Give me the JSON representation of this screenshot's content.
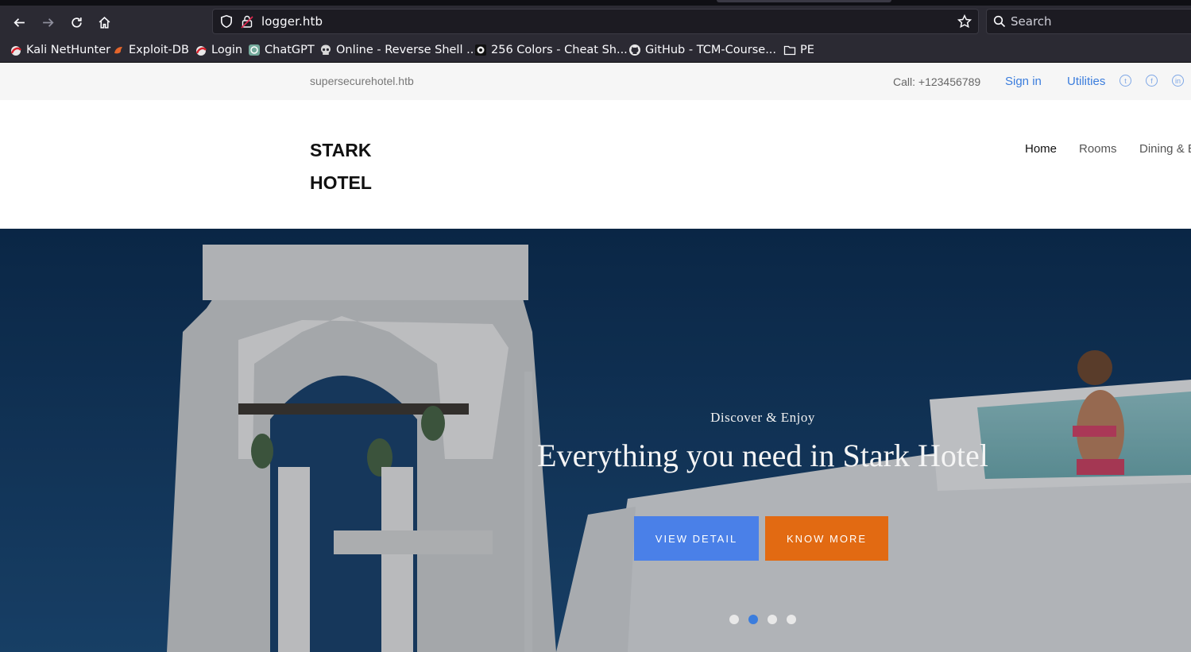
{
  "browser": {
    "url": "logger.htb",
    "search_placeholder": "Search",
    "bookmarks": [
      {
        "label": "Kali NetHunter",
        "icon": "kali-nethunter-icon"
      },
      {
        "label": "Exploit-DB",
        "icon": "exploit-db-icon"
      },
      {
        "label": "Login",
        "icon": "login-icon"
      },
      {
        "label": "ChatGPT",
        "icon": "chatgpt-icon"
      },
      {
        "label": "Online - Reverse Shell ...",
        "icon": "skull-icon"
      },
      {
        "label": "256 Colors - Cheat Sh...",
        "icon": "colors-icon"
      },
      {
        "label": "GitHub - TCM-Course...",
        "icon": "github-icon"
      },
      {
        "label": "PE",
        "icon": "folder-icon"
      }
    ]
  },
  "site": {
    "topbar": {
      "domain": "supersecurehotel.htb",
      "call": "Call: +123456789",
      "signin": "Sign in",
      "utilities": "Utilities",
      "social": [
        "twitter-icon",
        "facebook-icon",
        "linkedin-icon"
      ]
    },
    "logo_line1": "STARK",
    "logo_line2": "HOTEL",
    "nav": [
      "Home",
      "Rooms",
      "Dining & E"
    ],
    "hero": {
      "kicker": "Discover & Enjoy",
      "headline": "Everything you need in Stark Hotel",
      "btn_view": "VIEW DETAIL",
      "btn_more": "KNOW MORE",
      "slide_count": 4,
      "active_slide": 2
    },
    "colors": {
      "accent_blue": "#4a80e8",
      "accent_orange": "#e26a12",
      "link_blue": "#3b7ddd"
    }
  }
}
